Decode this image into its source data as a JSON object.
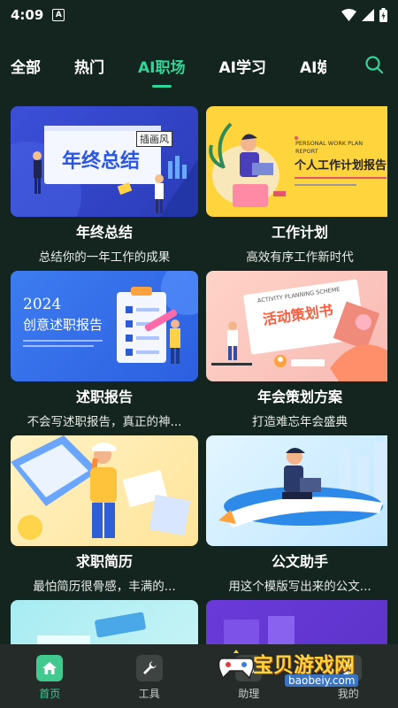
{
  "status": {
    "time": "4:09",
    "notif": "A"
  },
  "tabs": [
    {
      "label": "全部"
    },
    {
      "label": "热门"
    },
    {
      "label": "AI职场"
    },
    {
      "label": "AI学习"
    },
    {
      "label": "AI娱"
    }
  ],
  "active_tab": "AI职场",
  "cards": [
    {
      "title": "年终总结",
      "sub": "总结你的一年工作的成果",
      "thumb": {
        "year_title": "年终总结",
        "tag": "插画风"
      }
    },
    {
      "title": "工作计划",
      "sub": "高效有序工作新时代",
      "thumb": {
        "en": "PERSONAL WORK PLAN",
        "report": "REPORT",
        "cn": "个人工作计划报告"
      }
    },
    {
      "title": "述职报告",
      "sub": "不会写述职报告，真正的神...",
      "thumb": {
        "year": "2024",
        "cn": "创意述职报告"
      }
    },
    {
      "title": "年会策划方案",
      "sub": "打造难忘年会盛典",
      "thumb": {
        "en": "ACTIVITY PLANNING SCHEME",
        "cn": "活动策划书"
      }
    },
    {
      "title": "求职简历",
      "sub": "最怕简历很骨感，丰满的...",
      "thumb": {}
    },
    {
      "title": "公文助手",
      "sub": "用这个模版写出来的公文...",
      "thumb": {}
    },
    {
      "title": "",
      "sub": "",
      "thumb": {}
    },
    {
      "title": "",
      "sub": "",
      "thumb": {}
    }
  ],
  "nav": [
    {
      "label": "首页"
    },
    {
      "label": "工具"
    },
    {
      "label": "助理"
    },
    {
      "label": "我的"
    }
  ],
  "watermark": {
    "text": "宝贝游戏网",
    "url": "baobeiy.com"
  },
  "colors": {
    "accent": "#2fd69a",
    "background": "#14241e",
    "nav_bg": "#242b28"
  }
}
